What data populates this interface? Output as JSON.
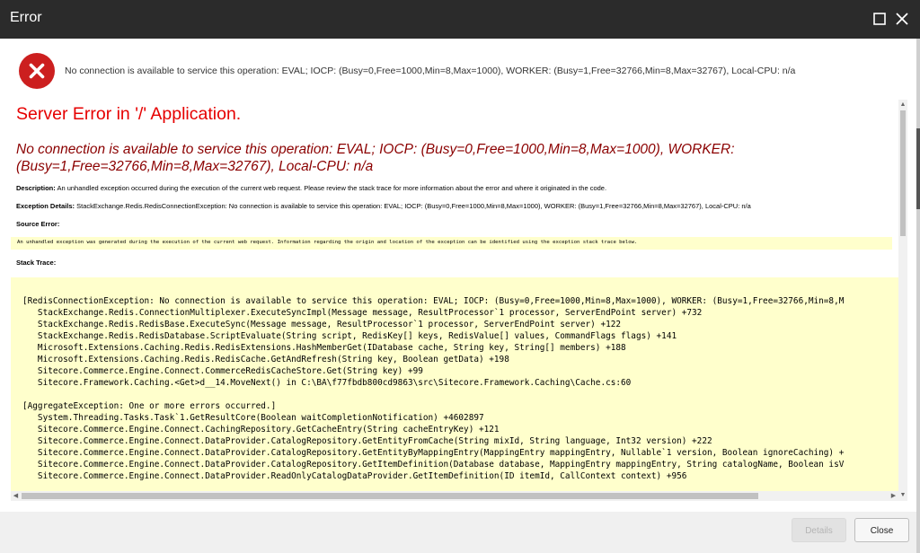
{
  "window": {
    "title": "Error"
  },
  "message": {
    "text": "No connection is available to service this operation: EVAL; IOCP: (Busy=0,Free=1000,Min=8,Max=1000), WORKER: (Busy=1,Free=32766,Min=8,Max=32767), Local-CPU: n/a"
  },
  "page": {
    "heading": "Server Error in '/' Application.",
    "error_title": "No connection is available to service this operation: EVAL; IOCP: (Busy=0,Free=1000,Min=8,Max=1000), WORKER: (Busy=1,Free=32766,Min=8,Max=32767), Local-CPU: n/a",
    "description_label": "Description:",
    "description_text": "An unhandled exception occurred during the execution of the current web request. Please review the stack trace for more information about the error and where it originated in the code.",
    "details_label": "Exception Details:",
    "details_text": "StackExchange.Redis.RedisConnectionException: No connection is available to service this operation: EVAL; IOCP: (Busy=0,Free=1000,Min=8,Max=1000), WORKER: (Busy=1,Free=32766,Min=8,Max=32767), Local-CPU: n/a",
    "source_label": "Source Error:",
    "source_text": "An unhandled exception was generated during the execution of the current web request. Information regarding the origin and location of the exception can be identified using the exception stack trace below.",
    "stack_label": "Stack Trace:",
    "stack_trace": "[RedisConnectionException: No connection is available to service this operation: EVAL; IOCP: (Busy=0,Free=1000,Min=8,Max=1000), WORKER: (Busy=1,Free=32766,Min=8,M\n   StackExchange.Redis.ConnectionMultiplexer.ExecuteSyncImpl(Message message, ResultProcessor`1 processor, ServerEndPoint server) +732\n   StackExchange.Redis.RedisBase.ExecuteSync(Message message, ResultProcessor`1 processor, ServerEndPoint server) +122\n   StackExchange.Redis.RedisDatabase.ScriptEvaluate(String script, RedisKey[] keys, RedisValue[] values, CommandFlags flags) +141\n   Microsoft.Extensions.Caching.Redis.RedisExtensions.HashMemberGet(IDatabase cache, String key, String[] members) +188\n   Microsoft.Extensions.Caching.Redis.RedisCache.GetAndRefresh(String key, Boolean getData) +198\n   Sitecore.Commerce.Engine.Connect.CommerceRedisCacheStore.Get(String key) +99\n   Sitecore.Framework.Caching.<Get>d__14.MoveNext() in C:\\BA\\f77fbdb800cd9863\\src\\Sitecore.Framework.Caching\\Cache.cs:60\n\n[AggregateException: One or more errors occurred.]\n   System.Threading.Tasks.Task`1.GetResultCore(Boolean waitCompletionNotification) +4602897\n   Sitecore.Commerce.Engine.Connect.CachingRepository.GetCacheEntry(String cacheEntryKey) +121\n   Sitecore.Commerce.Engine.Connect.DataProvider.CatalogRepository.GetEntityFromCache(String mixId, String language, Int32 version) +222\n   Sitecore.Commerce.Engine.Connect.DataProvider.CatalogRepository.GetEntityByMappingEntry(MappingEntry mappingEntry, Nullable`1 version, Boolean ignoreCaching) +\n   Sitecore.Commerce.Engine.Connect.DataProvider.CatalogRepository.GetItemDefinition(Database database, MappingEntry mappingEntry, String catalogName, Boolean isV\n   Sitecore.Commerce.Engine.Connect.DataProvider.ReadOnlyCatalogDataProvider.GetItemDefinition(ID itemId, CallContext context) +956"
  },
  "footer": {
    "details_label": "Details",
    "close_label": "Close"
  },
  "icons": {
    "error": "error-circle-icon",
    "maximize": "maximize-icon",
    "close": "close-icon"
  },
  "colors": {
    "titlebar": "#2b2b2b",
    "error_icon": "#cc1f1f",
    "heading": "#e60000",
    "error_title": "#8b0000",
    "code_background": "#ffffcc"
  }
}
